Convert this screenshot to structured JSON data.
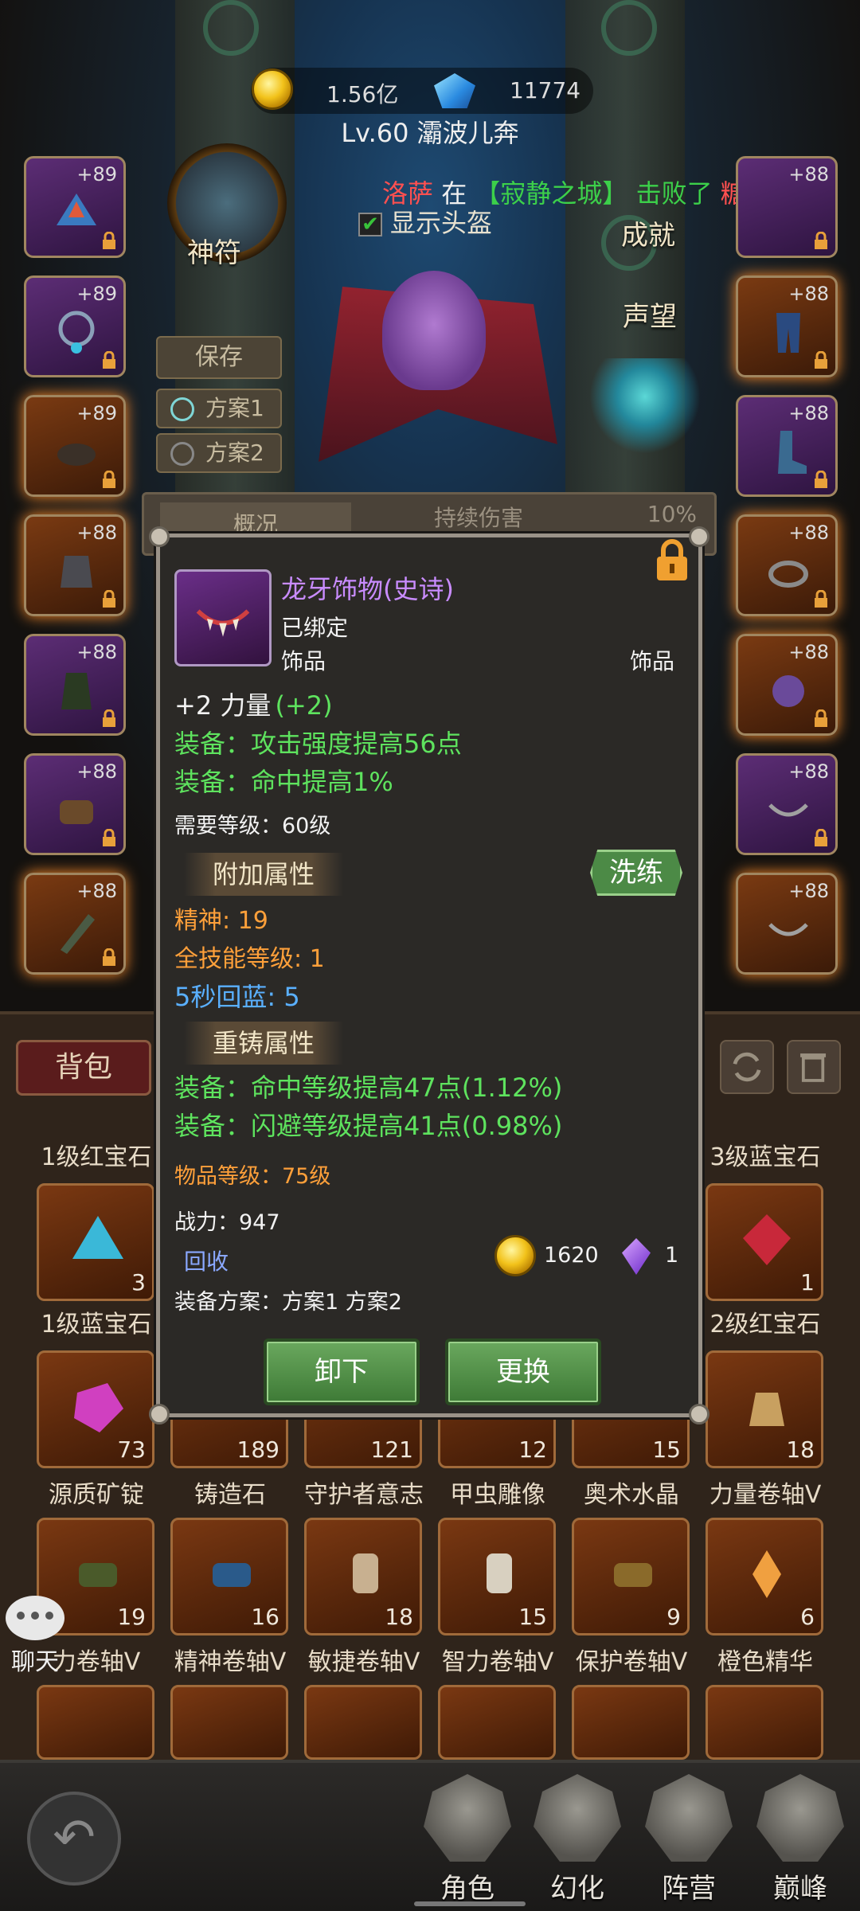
{
  "header": {
    "gold": "1.56亿",
    "gems": "11774",
    "player": "Lv.60 灞波儿奔"
  },
  "broadcast": {
    "part1": "洛萨",
    "part2": "在",
    "part3": "【寂静之城】",
    "part4": "击败了",
    "part5": "糖霜史"
  },
  "controls": {
    "helm_label": "显示头盔",
    "save": "保存",
    "plan1": "方案1",
    "plan2": "方案2",
    "god_label": "神符",
    "achievement": "成就",
    "reputation": "声望"
  },
  "left_slots": [
    "+89",
    "+89",
    "+89",
    "+88",
    "+88",
    "+88",
    "+88"
  ],
  "right_slots": [
    "+88",
    "+88",
    "+88",
    "+88",
    "+88",
    "+88",
    "+88"
  ],
  "popup_behind": {
    "tab": "概况",
    "hint": "持续伤害",
    "pct": "10%"
  },
  "item": {
    "name": "龙牙饰物(史诗)",
    "bound": "已绑定",
    "type_left": "饰品",
    "type_right": "饰品",
    "base_stat": "+2 力量",
    "base_bonus": "(+2)",
    "equip1": "装备：攻击强度提高56点",
    "equip2": "装备：命中提高1%",
    "req_level": "需要等级：60级",
    "extra_title": "附加属性",
    "reroll": "洗练",
    "extra1": "精神: 19",
    "extra2": "全技能等级: 1",
    "extra3": "5秒回蓝: 5",
    "reforge_title": "重铸属性",
    "reforge1": "装备：命中等级提高47点(1.12%)",
    "reforge2": "装备：闪避等级提高41点(0.98%)",
    "item_level": "物品等级：75级",
    "power": "战力：947",
    "recycle": "回收",
    "price_gold": "1620",
    "price_gem": "1",
    "plans": "装备方案：方案1  方案2",
    "unequip": "卸下",
    "replace": "更换"
  },
  "inventory": {
    "bag_tab": "背包",
    "row0_labels": [
      "1级红宝石",
      "3级蓝宝石"
    ],
    "row1": [
      {
        "label": "1级蓝宝石",
        "count": "3"
      },
      {
        "label": "2级红宝石",
        "count": "1"
      }
    ],
    "row2": [
      {
        "label": "源质矿锭",
        "count": "73"
      },
      {
        "label": "铸造石",
        "count": "189"
      },
      {
        "label": "守护者意志",
        "count": "121"
      },
      {
        "label": "甲虫雕像",
        "count": "12"
      },
      {
        "label": "奥术水晶",
        "count": "15"
      },
      {
        "label": "力量卷轴V",
        "count": "18"
      }
    ],
    "row3": [
      {
        "label": "力卷轴V",
        "count": "19"
      },
      {
        "label": "精神卷轴V",
        "count": "16"
      },
      {
        "label": "敏捷卷轴V",
        "count": "18"
      },
      {
        "label": "智力卷轴V",
        "count": "15"
      },
      {
        "label": "保护卷轴V",
        "count": "9"
      },
      {
        "label": "橙色精华",
        "count": "6"
      }
    ]
  },
  "chat": "聊天",
  "nav": [
    "角色",
    "幻化",
    "阵营",
    "巅峰"
  ]
}
